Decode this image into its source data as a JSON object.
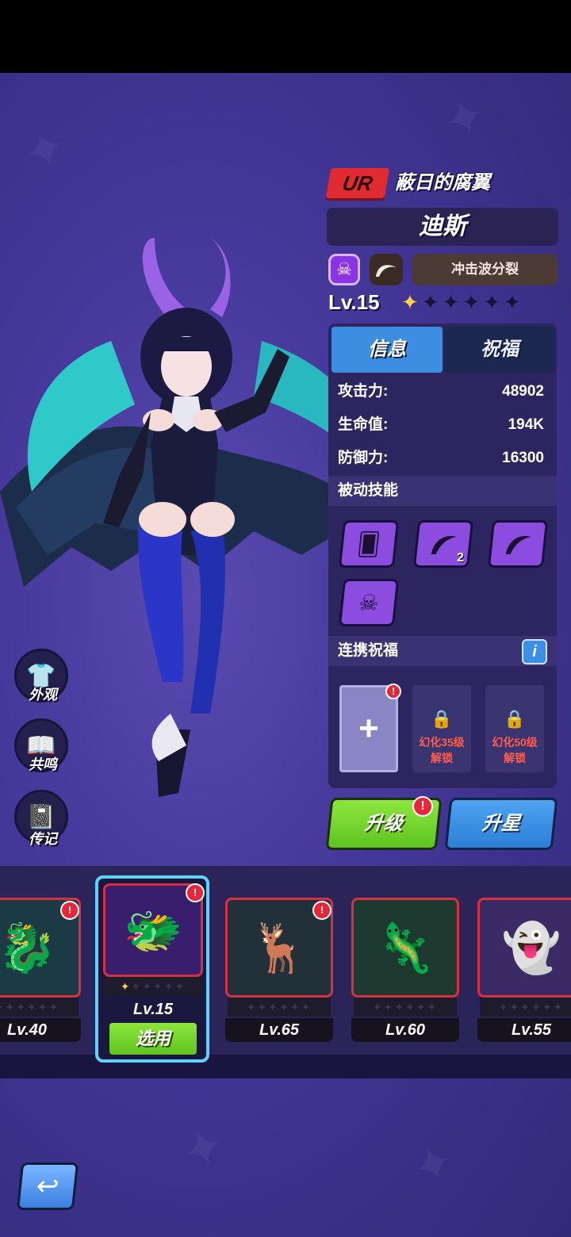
{
  "hero": {
    "rarity": "UR",
    "title": "蔽日的腐翼",
    "name": "迪斯",
    "skill_tag": "冲击波分裂",
    "level": "Lv.15",
    "stars_filled": 1,
    "stars_total": 6
  },
  "tabs": {
    "info": "信息",
    "bless": "祝福"
  },
  "stats": [
    {
      "label": "攻击力:",
      "value": "48902"
    },
    {
      "label": "生命值:",
      "value": "194K"
    },
    {
      "label": "防御力:",
      "value": "16300"
    }
  ],
  "sections": {
    "passive": "被动技能",
    "link_bless": "连携祝福",
    "info_glyph": "i"
  },
  "passive_skills": [
    {
      "icon": "cards-dice-icon",
      "count": ""
    },
    {
      "icon": "wing-icon",
      "count": "2"
    },
    {
      "icon": "wing-icon",
      "count": ""
    },
    {
      "icon": "skull-burst-icon",
      "count": ""
    }
  ],
  "link_slots": {
    "add_glyph": "+",
    "locked": [
      {
        "line1": "幻化35级",
        "line2": "解锁"
      },
      {
        "line1": "幻化50级",
        "line2": "解锁"
      }
    ]
  },
  "actions": {
    "upgrade": "升级",
    "star_up": "升星",
    "alert": "!"
  },
  "side_menu": [
    {
      "label": "外观",
      "icon": "shirt-icon"
    },
    {
      "label": "共鸣",
      "icon": "book-icon"
    },
    {
      "label": "传记",
      "icon": "journal-icon"
    }
  ],
  "roster": [
    {
      "level": "Lv.40",
      "icon": "bone-dragon-icon",
      "stars": 0,
      "selected": false
    },
    {
      "level": "Lv.15",
      "icon": "shadow-dragon-icon",
      "stars": 1,
      "selected": true,
      "select_label": "选用"
    },
    {
      "level": "Lv.65",
      "icon": "antler-beast-icon",
      "stars": 0,
      "selected": false
    },
    {
      "level": "Lv.60",
      "icon": "green-dragon-icon",
      "stars": 0,
      "selected": false
    },
    {
      "level": "Lv.55",
      "icon": "ghost-beast-icon",
      "stars": 0,
      "selected": false
    }
  ],
  "colors": {
    "rarity_red": "#e02b33",
    "tab_active": "#3d8de0",
    "upgrade_green": "#6fd22a",
    "star_blue": "#3b8fe6",
    "lock_text": "#ff5d4d",
    "badge_red": "#e8263a",
    "select_cyan": "#5fd2ff",
    "star_gold": "#ffd24a"
  }
}
